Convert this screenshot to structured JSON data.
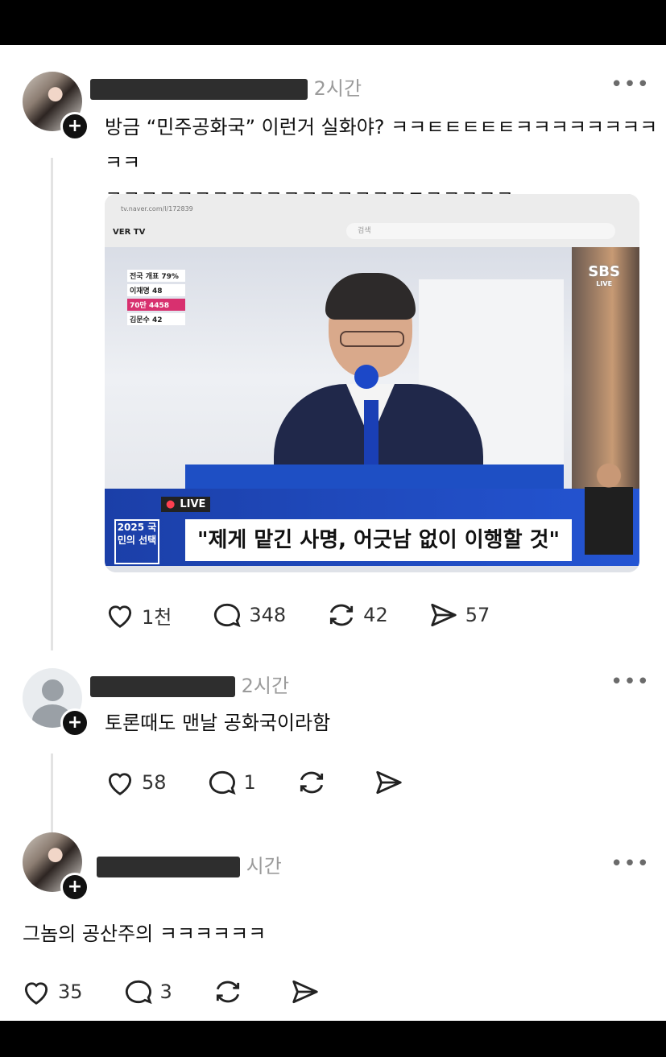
{
  "posts": [
    {
      "time": "2시간",
      "text_line1": "방금 “민주공화국” 이런거 실화야? ㅋㅋㅌㅌㅌㅌㅌㅋㅋㅋㅋㅋㅋㅋㅋㅋㅋ",
      "text_line2": "ㅋㅋㅋㅋㅋㅋㅋㅋㅋㅋㅋㅋㅋㅋㅋㅋㅋㅌㅋㅋㅋㅋㅋ",
      "likes": "1천",
      "comments": "348",
      "reposts": "42",
      "shares": "57"
    },
    {
      "time": "2시간",
      "text": "토론때도 맨날 공화국이라함",
      "likes": "58",
      "comments": "1"
    },
    {
      "time": "시간",
      "text": "그놈의 공산주의 ㅋㅋㅋㅋㅋㅋ",
      "likes": "35",
      "comments": "3"
    }
  ],
  "media": {
    "brand": "VER TV",
    "live_label": "LIVE",
    "broadcaster": "SBS",
    "broadcaster_sub": "LIVE",
    "program_badge": "2025 국민의 선택",
    "headline": "\"제게 맡긴 사명, 어긋남 없이 이행할 것\"",
    "tally": [
      "전국 개표 79%",
      "이재명 48",
      "70만 4458",
      "김문수 42"
    ]
  },
  "more_label": "•••"
}
